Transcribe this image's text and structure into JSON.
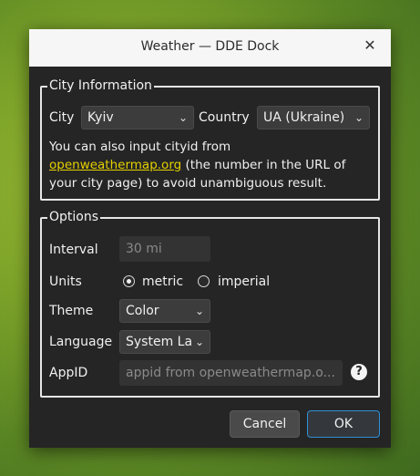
{
  "window": {
    "title": "Weather — DDE Dock"
  },
  "city_group": {
    "title": "City Information",
    "city_label": "City",
    "city_value": "Kyiv",
    "country_label": "Country",
    "country_value": "UA (Ukraine)",
    "info_line1": "You can also input cityid from",
    "link_text": "openweathermap.org",
    "info_line2_rest": " (the number in the URL of",
    "info_line3": "your city page) to avoid unambiguous result."
  },
  "options_group": {
    "title": "Options",
    "interval_label": "Interval",
    "interval_value": "30  mi",
    "units_label": "Units",
    "unit_metric": "metric",
    "unit_imperial": "imperial",
    "units_selected": "metric",
    "theme_label": "Theme",
    "theme_value": "Color",
    "language_label": "Language",
    "language_value": "System La",
    "appid_label": "AppID",
    "appid_placeholder": "appid from openweathermap.o..."
  },
  "buttons": {
    "cancel": "Cancel",
    "ok": "OK"
  },
  "icons": {
    "close": "close-icon",
    "help": "help-icon",
    "chevron": "chevron-down-icon"
  },
  "colors": {
    "link": "#e4d000",
    "ok_border": "#2e90d6"
  }
}
